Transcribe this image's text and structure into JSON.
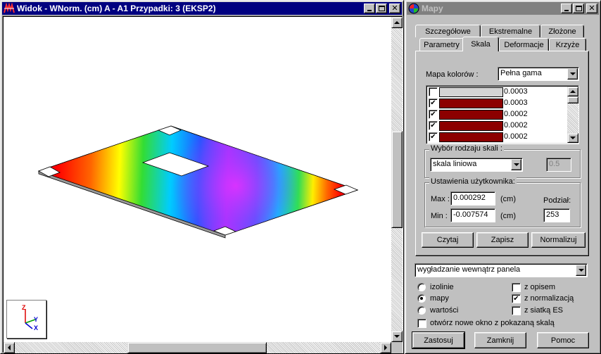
{
  "view_window": {
    "title": "Widok - WNorm. (cm) A - A1 Przypadki: 3 (EKSP2)",
    "axes": {
      "z": "Z",
      "y": "Y",
      "x": "X"
    }
  },
  "maps_window": {
    "title": "Mapy",
    "tabs_row1": [
      "Szczegółowe",
      "Ekstremalne",
      "Złożone"
    ],
    "tabs_row2": [
      "Parametry",
      "Skala",
      "Deformacje",
      "Krzyże"
    ],
    "active_tab": "Skala",
    "color_map_label": "Mapa kolorów :",
    "color_map_value": "Pełna gama",
    "scale_list": [
      {
        "checked": false,
        "color": "#d4d4d4",
        "value": "0.0003"
      },
      {
        "checked": true,
        "color": "#8c0000",
        "value": "0.0003"
      },
      {
        "checked": true,
        "color": "#8c0000",
        "value": "0.0002"
      },
      {
        "checked": true,
        "color": "#8c0000",
        "value": "0.0002"
      },
      {
        "checked": true,
        "color": "#8c0000",
        "value": "0.0002"
      }
    ],
    "scale_type_group": "Wybór rodzaju skali :",
    "scale_type_value": "skala liniowa",
    "scale_type_param": "0.5",
    "user_settings_group": "Ustawienia użytkownika:",
    "max_label": "Max :",
    "max_value": "0.000292",
    "max_unit": "(cm)",
    "min_label": "Min :",
    "min_value": "-0.007574",
    "min_unit": "(cm)",
    "division_label": "Podział:",
    "division_value": "253",
    "btn_read": "Czytaj",
    "btn_save": "Zapisz",
    "btn_normalize": "Normalizuj",
    "smoothing_value": "wygładzanie wewnątrz panela",
    "radio_isolines": "izolinie",
    "radio_maps": "mapy",
    "radio_values": "wartości",
    "radio_selected": "mapy",
    "chk_description": "z opisem",
    "chk_description_checked": false,
    "chk_normalization": "z normalizacją",
    "chk_normalization_checked": true,
    "chk_grid": "z siatką ES",
    "chk_grid_checked": false,
    "chk_new_window": "otwórz nowe okno z pokazaną skalą",
    "chk_new_window_checked": false,
    "btn_apply": "Zastosuj",
    "btn_close": "Zamknij",
    "btn_help": "Pomoc"
  },
  "colors": {
    "title_active": "#000080",
    "title_inactive": "#808080",
    "face": "#c0c0c0"
  }
}
